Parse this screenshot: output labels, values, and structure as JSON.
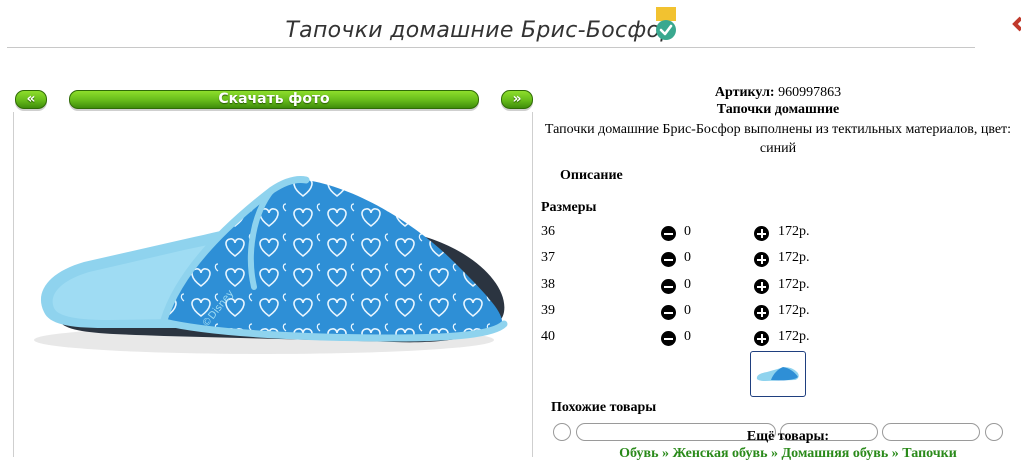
{
  "page": {
    "title": "Тапочки домашние Брис-Босфор"
  },
  "gallery": {
    "prev_label": "«",
    "download_label": "Скачать фото",
    "next_label": "»"
  },
  "product": {
    "article_label": "Артикул:",
    "article_value": "960997863",
    "name": "Тапочки домашние",
    "description": "Тапочки домашние Брис-Босфор выполнены из тектильных материалов, цвет: синий",
    "description_heading": "Описание",
    "sizes_heading": "Размеры",
    "sizes": [
      {
        "size": "36",
        "qty": "0",
        "price": "172р."
      },
      {
        "size": "37",
        "qty": "0",
        "price": "172р."
      },
      {
        "size": "38",
        "qty": "0",
        "price": "172р."
      },
      {
        "size": "39",
        "qty": "0",
        "price": "172р."
      },
      {
        "size": "40",
        "qty": "0",
        "price": "172р."
      }
    ],
    "photo_brand": "©Disney"
  },
  "similar": {
    "heading": "Похожие товары"
  },
  "more": {
    "heading": "Ещё товары:",
    "breadcrumb": [
      "Обувь",
      "Женская обувь",
      "Домашняя обувь",
      "Тапочки"
    ],
    "separator": " » "
  },
  "colors": {
    "green_button": "#66bb1a",
    "breadcrumb_green": "#2a8a1a",
    "slipper_blue": "#2e8fd6",
    "slipper_light": "#8fd3ee"
  }
}
